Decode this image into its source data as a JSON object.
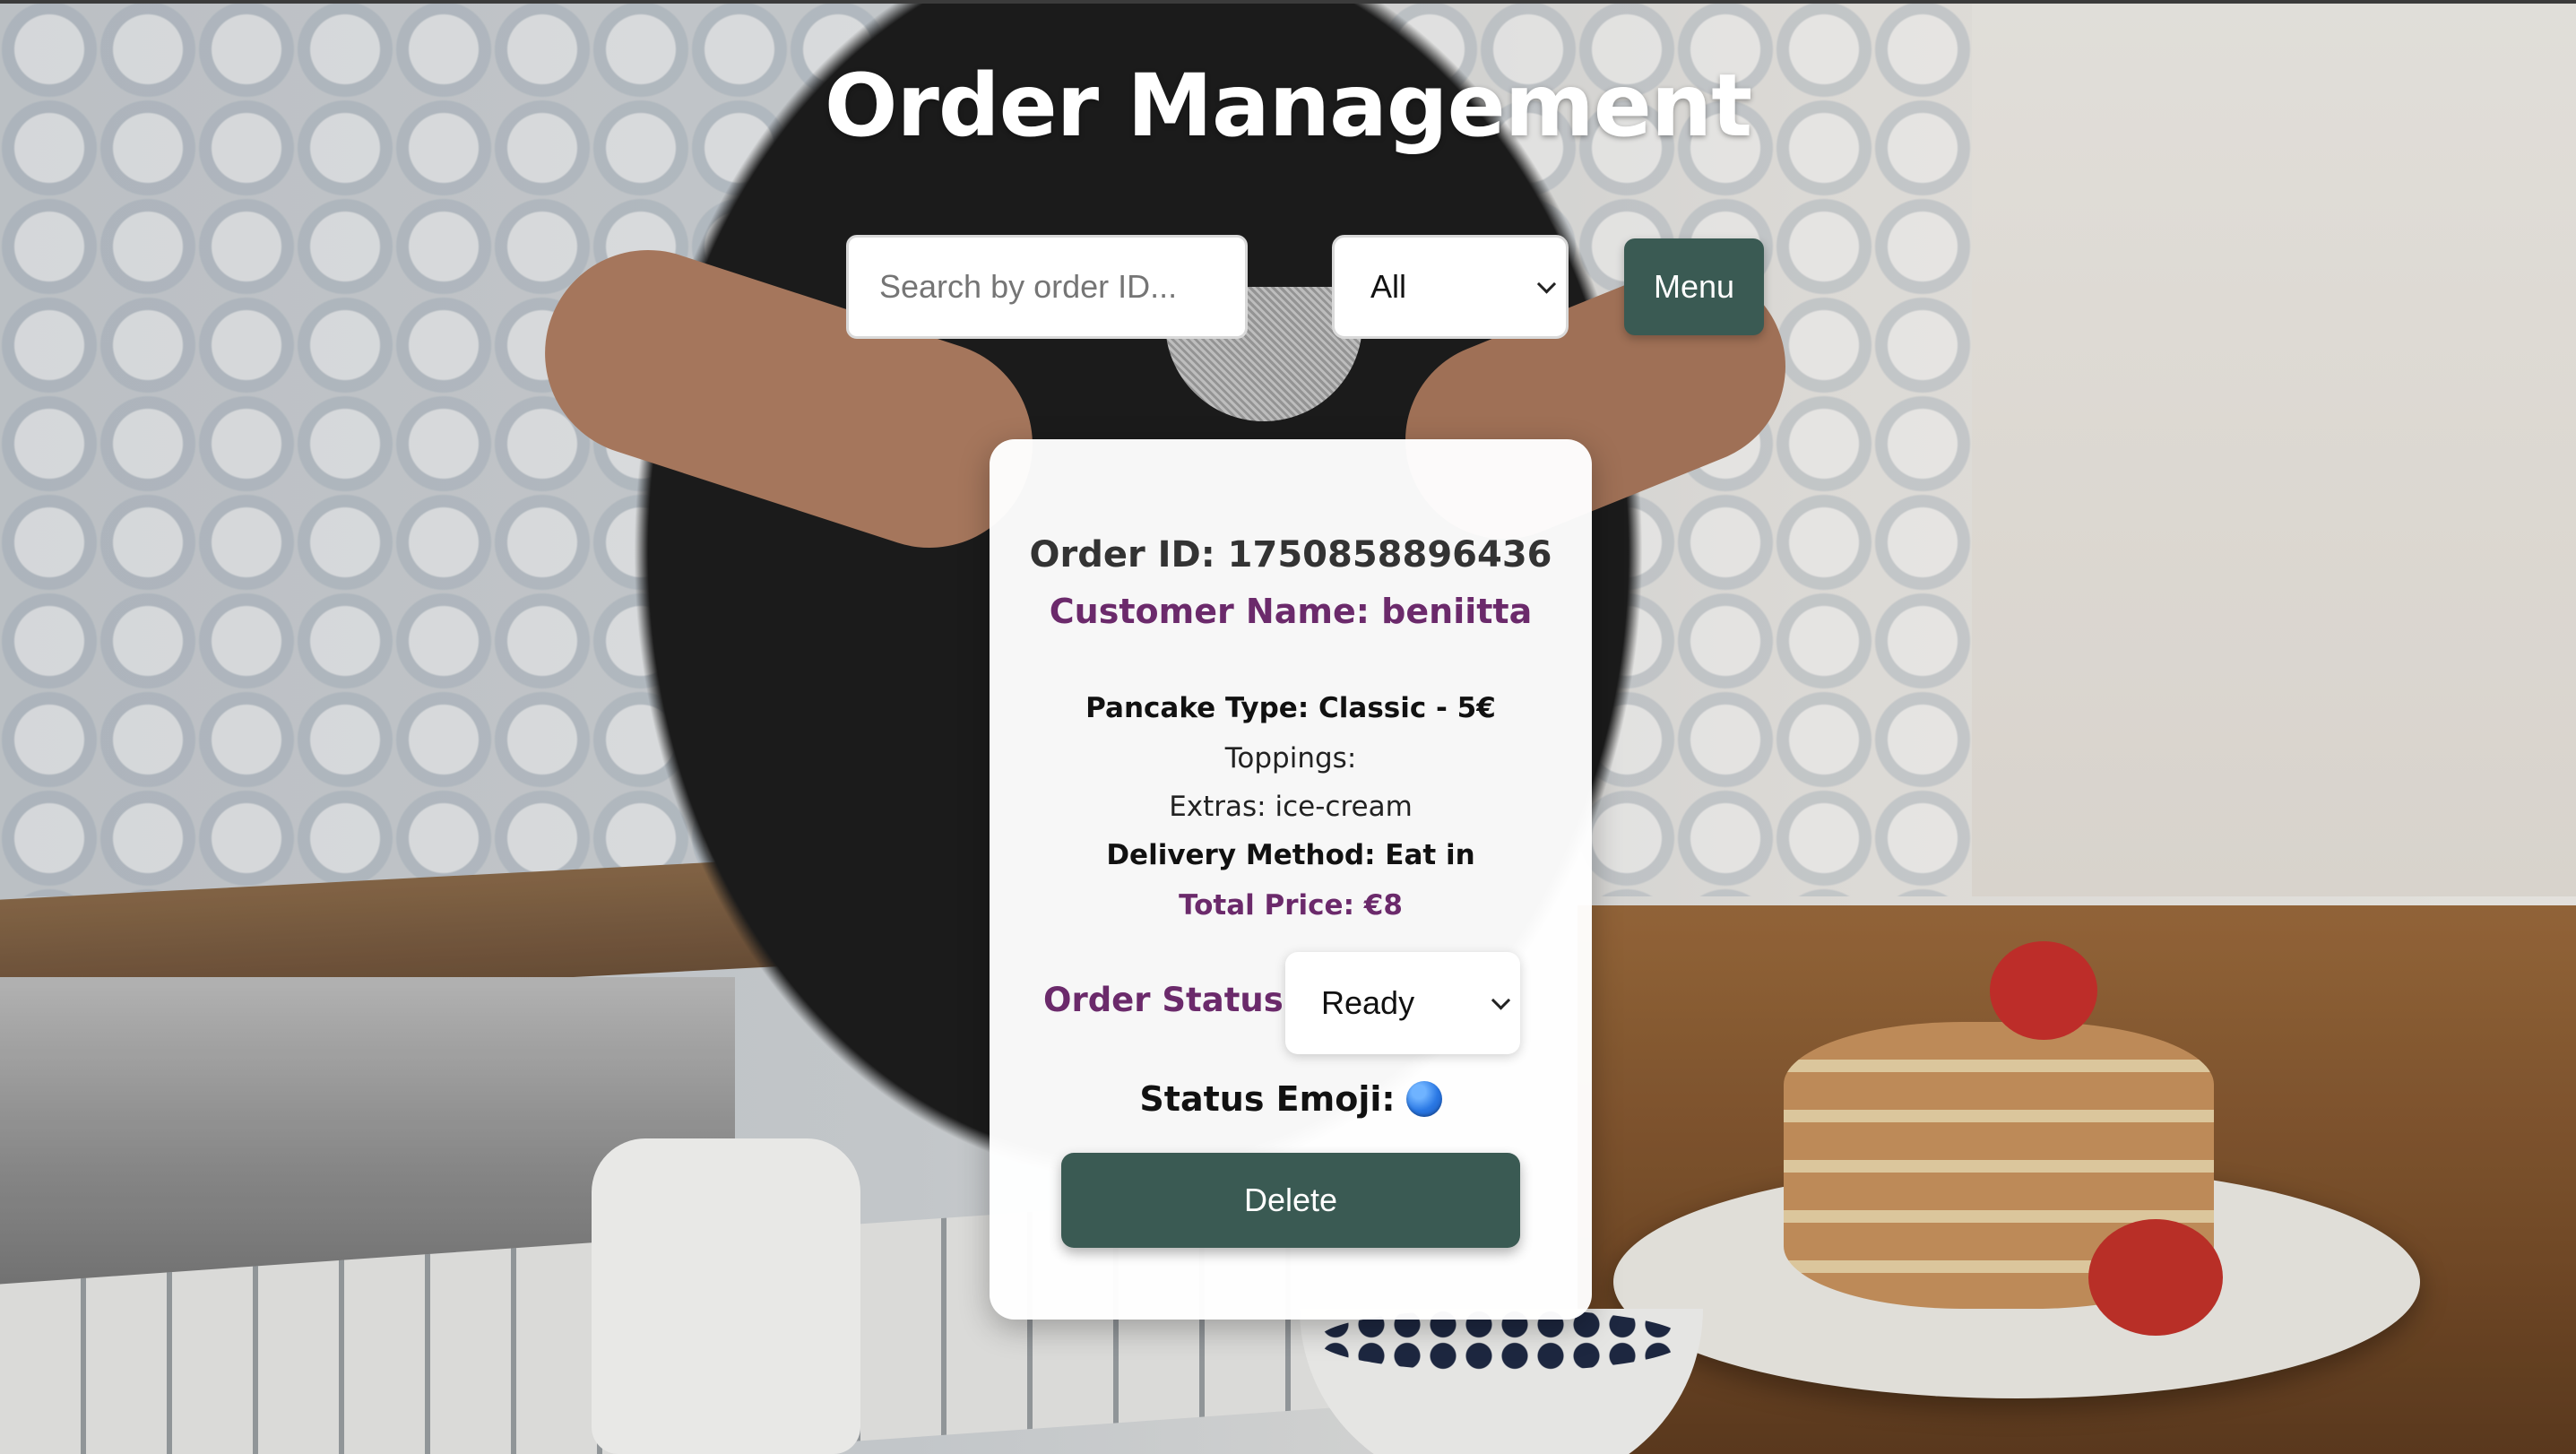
{
  "page": {
    "title": "Order Management"
  },
  "toolbar": {
    "search_placeholder": "Search by order ID...",
    "filter_selected": "All",
    "menu_label": "Menu"
  },
  "order": {
    "order_id_line": "Order ID: 1750858896436",
    "customer_line": "Customer Name: beniitta",
    "pancake_line": "Pancake Type: Classic - 5€",
    "toppings_line": "Toppings:",
    "extras_line": "Extras: ice-cream",
    "delivery_line": "Delivery Method: Eat in",
    "total_line": "Total Price: €8",
    "status_label": "Order Status:",
    "status_selected": "Ready",
    "emoji_label": "Status Emoji:",
    "emoji_icon": "blue-circle-icon",
    "delete_label": "Delete"
  },
  "colors": {
    "accent_green": "#3a5a53",
    "accent_purple": "#6b2a6b",
    "card_background": "#ffffff"
  }
}
